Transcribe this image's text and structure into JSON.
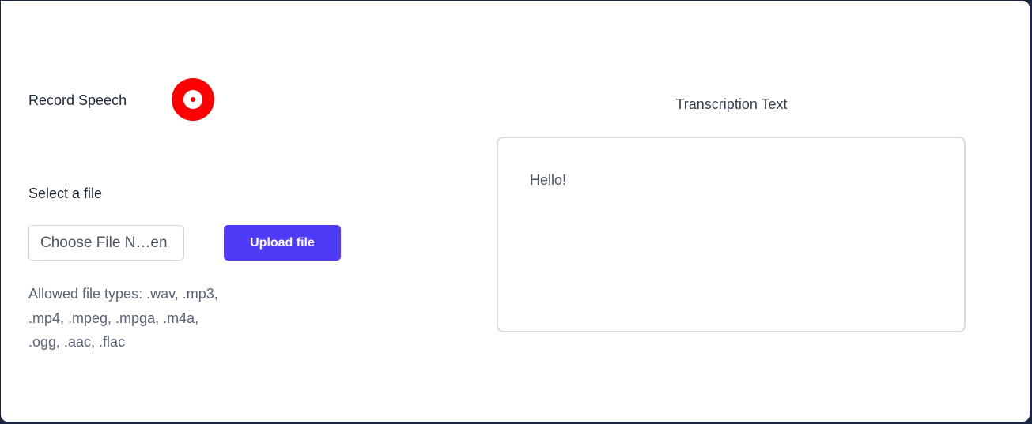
{
  "record": {
    "label": "Record Speech",
    "icon": "record-icon",
    "color": "#ff0000"
  },
  "upload": {
    "select_label": "Select a file",
    "file_input_text": "Choose File N…en",
    "button_label": "Upload file",
    "button_color": "#4f3af5",
    "allowed_types_line1": "Allowed file types: .wav, .mp3,",
    "allowed_types_line2": ".mp4, .mpeg, .mpga, .m4a,",
    "allowed_types_line3": ".ogg, .aac, .flac"
  },
  "transcription": {
    "title": "Transcription Text",
    "text": "Hello!"
  }
}
